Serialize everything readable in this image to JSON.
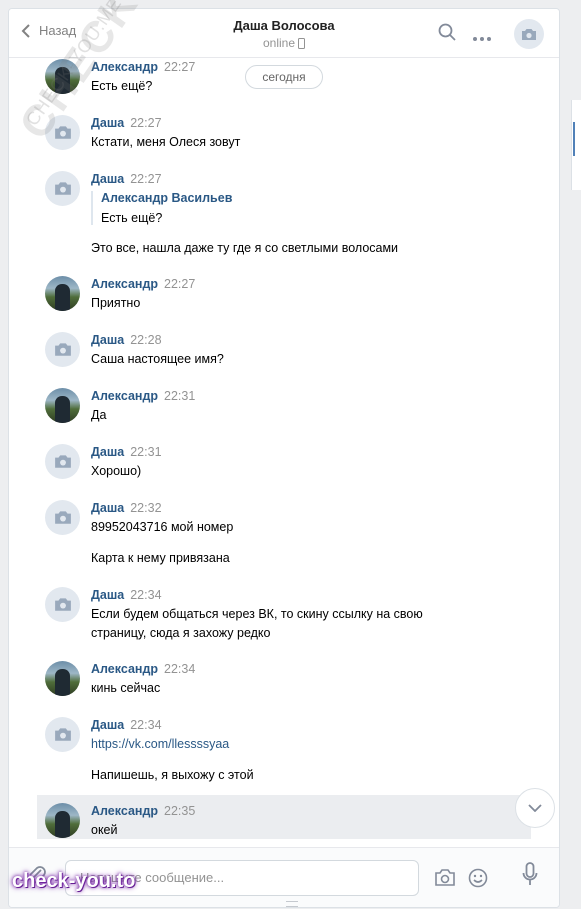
{
  "header": {
    "back_label": "Назад",
    "contact_name": "Даша Волосова",
    "status": "online"
  },
  "date_divider": "сегодня",
  "messages": [
    {
      "author": "Александр",
      "time": "22:27",
      "lines": [
        "Есть ещё?"
      ],
      "avatar": "photo"
    },
    {
      "author": "Даша",
      "time": "22:27",
      "lines": [
        "Кстати, меня Олеся зовут"
      ],
      "avatar": "camera"
    },
    {
      "author": "Даша",
      "time": "22:27",
      "avatar": "camera",
      "forwarded": {
        "author": "Александр Васильев",
        "text": "Есть ещё?"
      },
      "lines": [
        "Это все, нашла даже ту где я со светлыми волосами"
      ]
    },
    {
      "author": "Александр",
      "time": "22:27",
      "lines": [
        "Приятно"
      ],
      "avatar": "photo"
    },
    {
      "author": "Даша",
      "time": "22:28",
      "lines": [
        "Саша настоящее имя?"
      ],
      "avatar": "camera"
    },
    {
      "author": "Александр",
      "time": "22:31",
      "lines": [
        "Да"
      ],
      "avatar": "photo"
    },
    {
      "author": "Даша",
      "time": "22:31",
      "lines": [
        "Хорошо)"
      ],
      "avatar": "camera"
    },
    {
      "author": "Даша",
      "time": "22:32",
      "lines": [
        "89952043716 мой номер",
        "Карта к нему привязана"
      ],
      "avatar": "camera"
    },
    {
      "author": "Даша",
      "time": "22:34",
      "lines": [
        "Если будем общаться через ВК, то скину ссылку на свою",
        "страницу, сюда я захожу редко"
      ],
      "avatar": "camera"
    },
    {
      "author": "Александр",
      "time": "22:34",
      "lines": [
        "кинь сейчас"
      ],
      "avatar": "photo"
    },
    {
      "author": "Даша",
      "time": "22:34",
      "avatar": "camera",
      "link": "https://vk.com/llessssyaa",
      "lines": [
        "Напишешь, я выхожу с этой"
      ]
    },
    {
      "author": "Александр",
      "time": "22:35",
      "lines": [
        "окей"
      ],
      "avatar": "photo"
    }
  ],
  "composer": {
    "placeholder": "Напишите сообщение..."
  },
  "watermarks": {
    "diagonal": "CHECK-YOU.ME",
    "small": "CHECK-YOU.ME",
    "logo": "check-you.to"
  },
  "colors": {
    "link": "#2a5885",
    "time": "#939393",
    "background": "#edeef0",
    "highlight": "#ebedf0"
  }
}
